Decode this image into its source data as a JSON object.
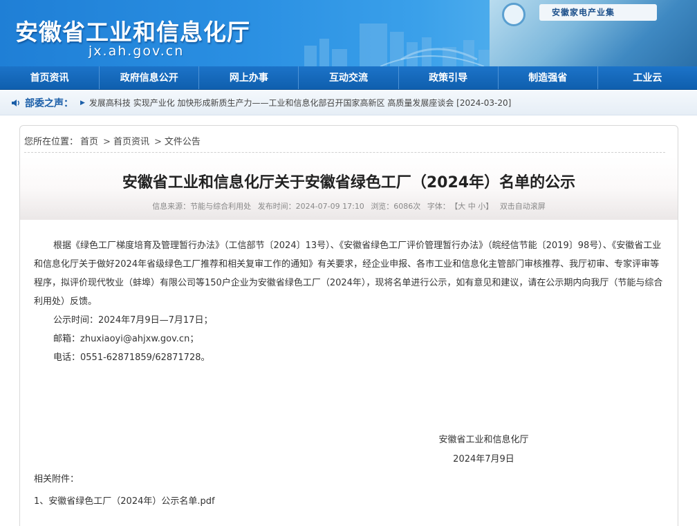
{
  "header": {
    "site_title": "安徽省工业和信息化厅",
    "domain": "jx.ah.gov.cn",
    "photo_sign": "安徽家电产业集"
  },
  "nav": {
    "items": [
      "首页资讯",
      "政府信息公开",
      "网上办事",
      "互动交流",
      "政策引导",
      "制造强省",
      "工业云"
    ]
  },
  "notice": {
    "label": "部委之声：",
    "headline": "发展高科技 实现产业化 加快形成新质生产力——工业和信息化部召开国家高新区 高质量发展座谈会 [2024-03-20]"
  },
  "breadcrumb": {
    "prefix": "您所在位置：",
    "items": [
      "首页",
      "首页资讯",
      "文件公告"
    ],
    "separator": ">"
  },
  "article": {
    "title": "安徽省工业和信息化厅关于安徽省绿色工厂（2024年）名单的公示",
    "meta": {
      "source": "信息来源：节能与综合利用处",
      "time": "发布时间：2024-07-09 17:10",
      "views": "浏览：6086次",
      "font_label": "字体：",
      "font_sizes": "【大 中 小】",
      "scroll": "双击自动滚屏"
    },
    "paragraph": "根据《绿色工厂梯度培育及管理暂行办法》（工信部节〔2024〕13号）、《安徽省绿色工厂评价管理暂行办法》（皖经信节能〔2019〕98号）、《安徽省工业和信息化厅关于做好2024年省级绿色工厂推荐和相关复审工作的通知》有关要求，经企业申报、各市工业和信息化主管部门审核推荐、我厅初审、专家评审等程序，拟评价现代牧业（蚌埠）有限公司等150户企业为安徽省绿色工厂（2024年），现将名单进行公示，如有意见和建议，请在公示期内向我厅（节能与综合利用处）反馈。",
    "lines": [
      "公示时间：2024年7月9日—7月17日；",
      "邮箱：zhuxiaoyi@ahjxw.gov.cn；",
      "电话：0551-62871859/62871728。"
    ],
    "signature": "安徽省工业和信息化厅",
    "date": "2024年7月9日",
    "attachments_label": "相关附件：",
    "attachment": "1、安徽省绿色工厂（2024年）公示名单.pdf"
  },
  "colors": {
    "nav_bg": "#1466b8",
    "accent": "#1a5ea8"
  }
}
